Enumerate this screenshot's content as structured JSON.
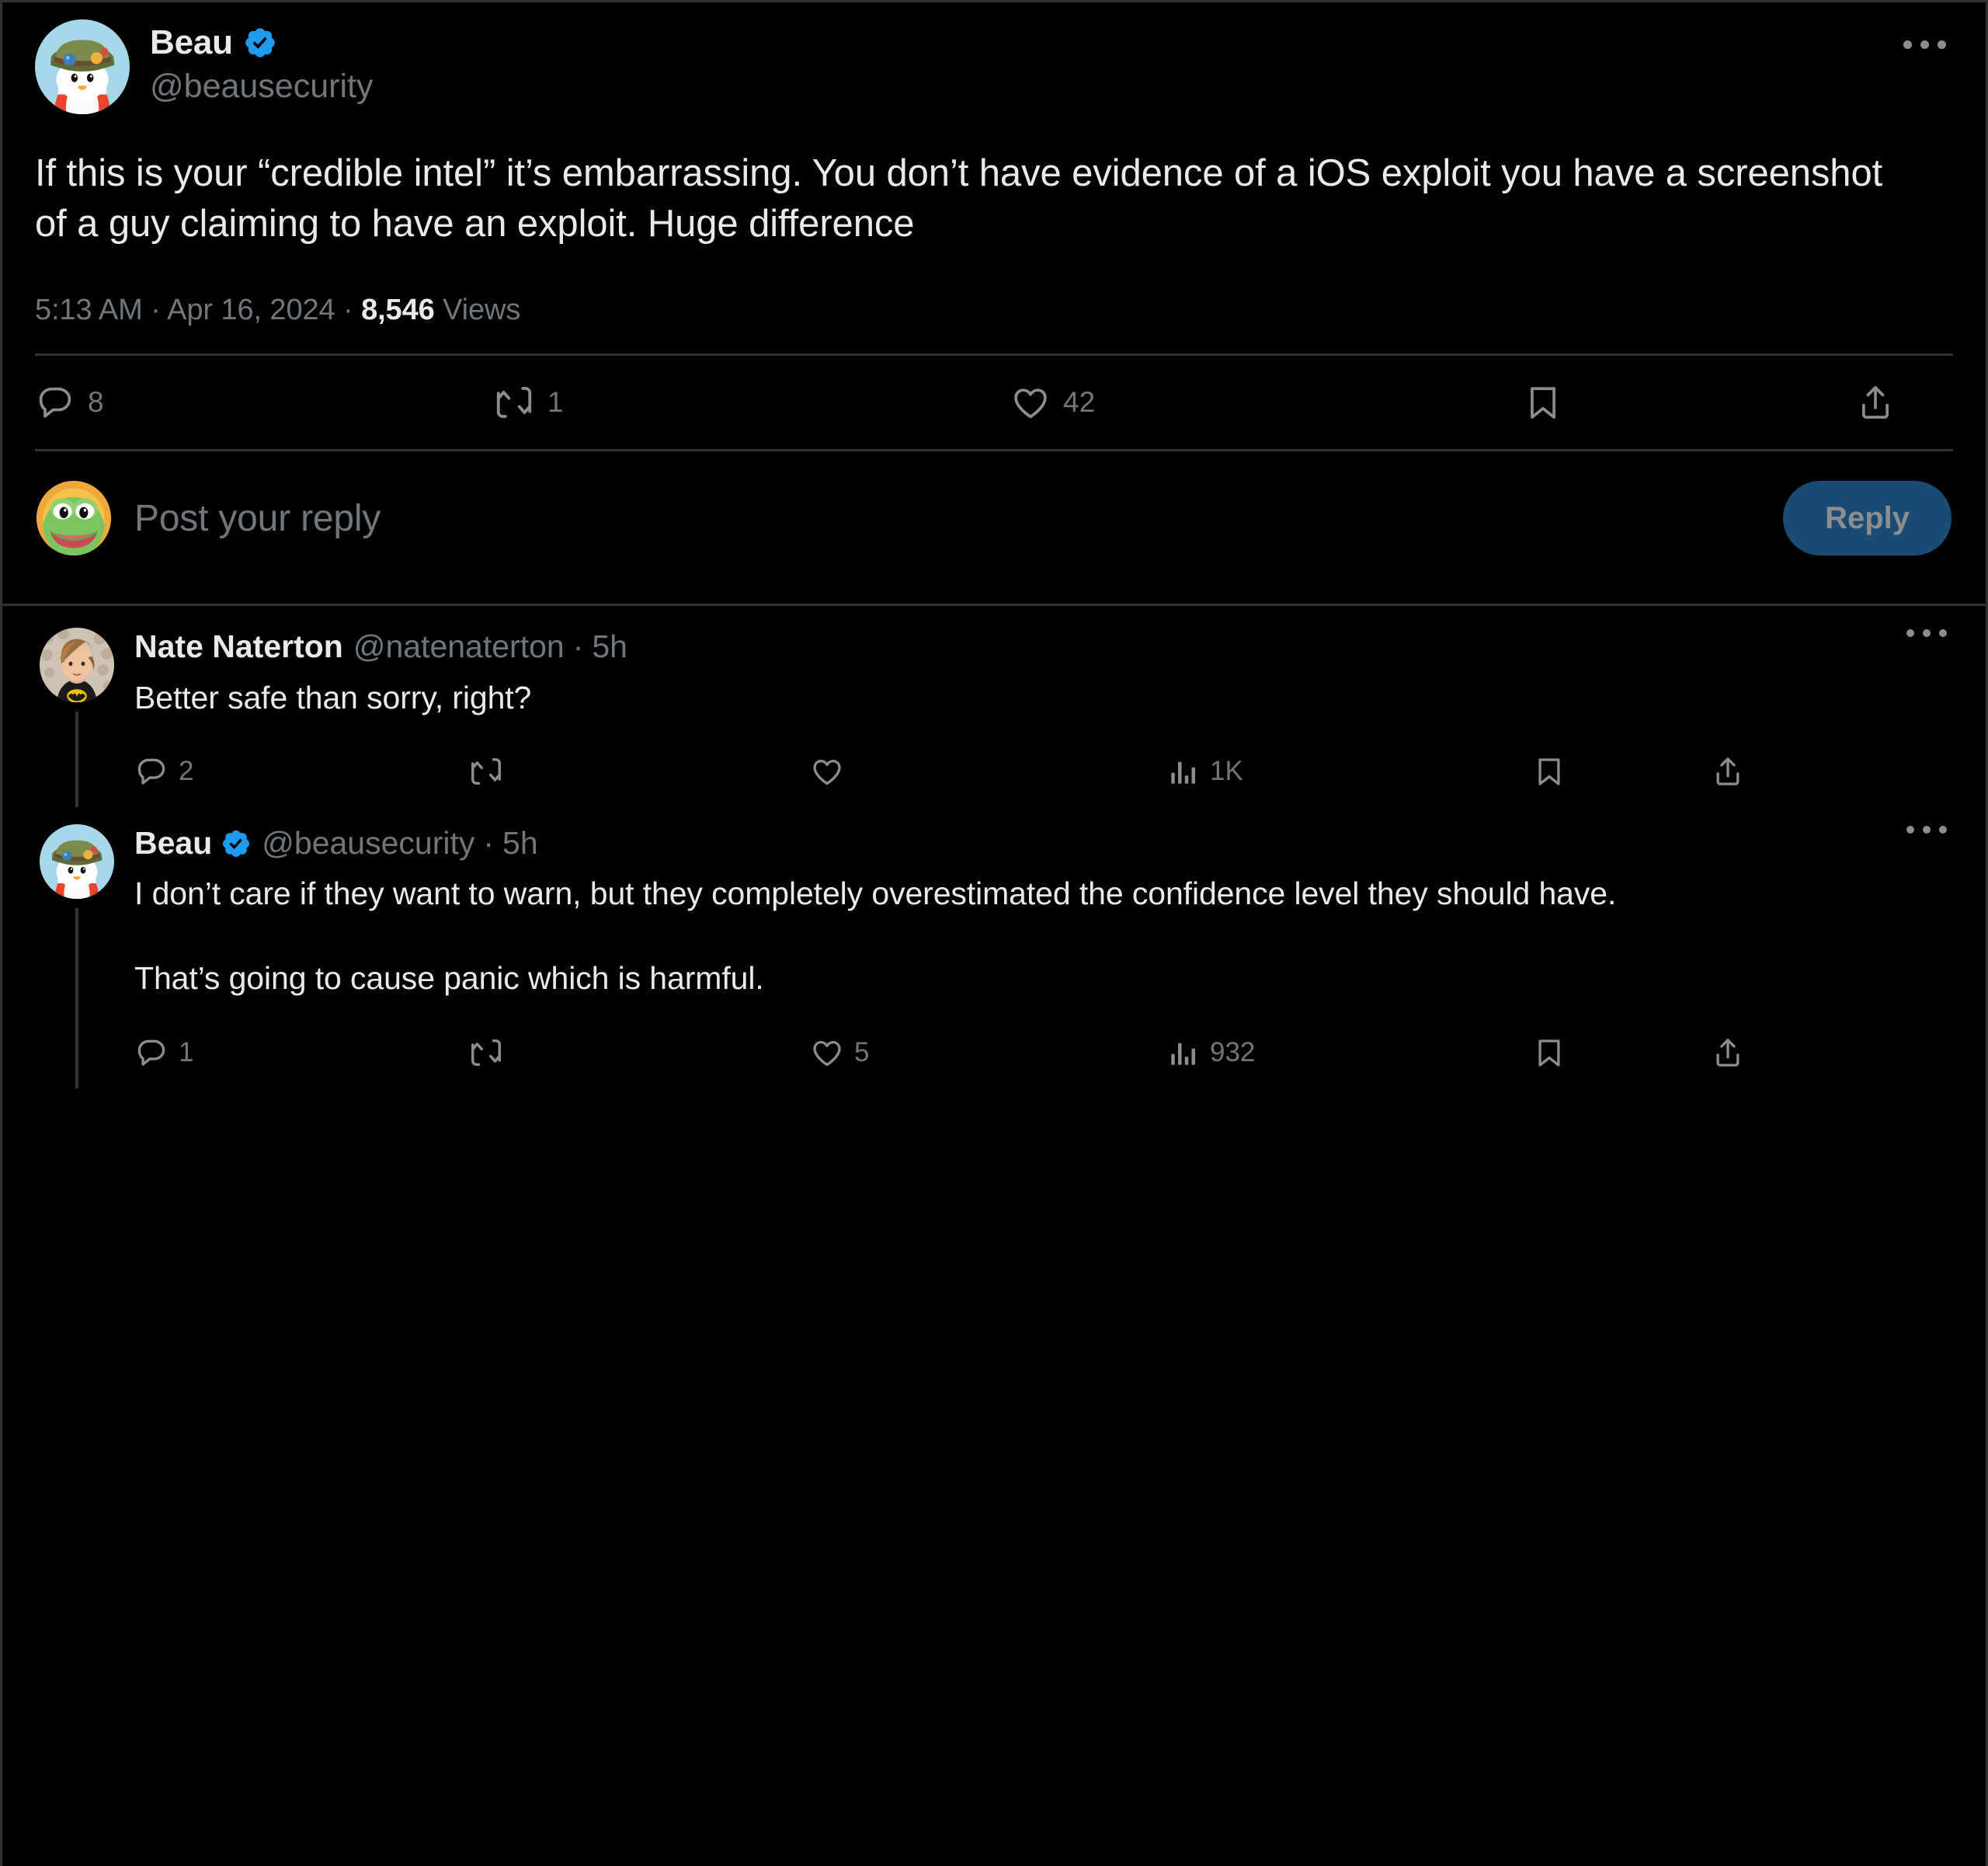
{
  "main_tweet": {
    "author": {
      "display_name": "Beau",
      "handle": "@beausecurity",
      "verified": true,
      "avatar_alt": "penguin-with-green-bucket-hat"
    },
    "text": "If this is your “credible intel” it’s embarrassing. You don’t have evidence of a iOS exploit you have a screenshot of a guy claiming to have an exploit. Huge difference",
    "timestamp": "5:13 AM",
    "separator": "·",
    "date": "Apr 16, 2024",
    "views_count": "8,546",
    "views_label": "Views",
    "actions": {
      "reply_count": "8",
      "retweet_count": "1",
      "like_count": "42",
      "bookmark_count": "",
      "share_count": ""
    }
  },
  "composer": {
    "avatar_alt": "green-frog-on-orange-background",
    "placeholder": "Post your reply",
    "reply_button_label": "Reply"
  },
  "replies": [
    {
      "display_name": "Nate Naterton",
      "handle": "@natenaterton",
      "verified": false,
      "separator": "·",
      "time": "5h",
      "avatar_alt": "person-in-batman-shirt",
      "text": "Better safe than sorry, right?",
      "actions": {
        "reply_count": "2",
        "retweet_count": "",
        "like_count": "",
        "views_count": "1K"
      }
    },
    {
      "display_name": "Beau",
      "handle": "@beausecurity",
      "verified": true,
      "separator": "·",
      "time": "5h",
      "avatar_alt": "penguin-with-green-bucket-hat",
      "text": "I don’t care if they want to warn, but they completely overestimated the confidence level they should have.\n\nThat’s going to cause panic which is harmful.",
      "actions": {
        "reply_count": "1",
        "retweet_count": "",
        "like_count": "5",
        "views_count": "932"
      }
    }
  ],
  "colors": {
    "background": "#000000",
    "text_primary": "#e7e9ea",
    "text_secondary": "#71767b",
    "border": "#2f3336",
    "verified_blue": "#1d9bf0",
    "reply_button_bg": "#1a4b74",
    "reply_button_text": "#8b8d8f"
  },
  "icons": {
    "more": "more-horizontal-icon",
    "reply": "reply-icon",
    "retweet": "retweet-icon",
    "like": "heart-icon",
    "bookmark": "bookmark-icon",
    "share": "share-icon",
    "views": "analytics-bar-icon",
    "verified": "verified-badge-icon"
  }
}
